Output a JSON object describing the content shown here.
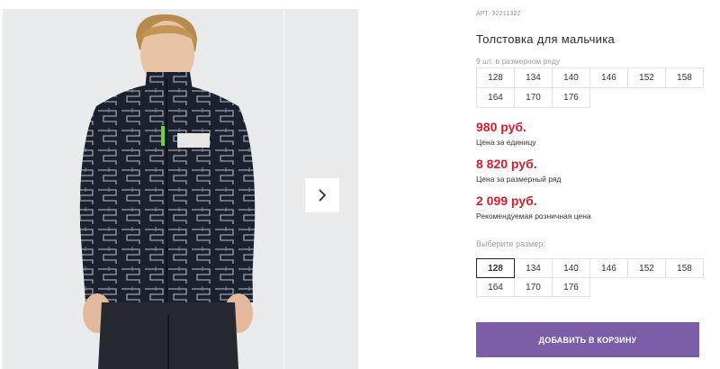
{
  "gallery": {
    "next_icon": "chevron-right-icon"
  },
  "product": {
    "sku": "АРТ. 32211322",
    "title": "Толстовка для мальчика",
    "pack_caption": "9 шт. в размерном ряду",
    "pack_sizes": [
      "128",
      "134",
      "140",
      "146",
      "152",
      "158",
      "164",
      "170",
      "176"
    ],
    "prices": [
      {
        "value": "980 руб.",
        "caption": "Цена за единицу"
      },
      {
        "value": "8 820 руб.",
        "caption": "Цена за размерный ряд"
      },
      {
        "value": "2 099 руб.",
        "caption": "Рекомендуемая розничная цена"
      }
    ],
    "choose_label": "Выберите размер:",
    "selectable_sizes": [
      "128",
      "134",
      "140",
      "146",
      "152",
      "158",
      "164",
      "170",
      "176"
    ],
    "selected_size": "128",
    "add_to_cart_label": "ДОБАВИТЬ В КОРЗИНУ"
  },
  "colors": {
    "price": "#d4202e",
    "button": "#7b5ea7",
    "photo_bg": "#e9eaec"
  }
}
